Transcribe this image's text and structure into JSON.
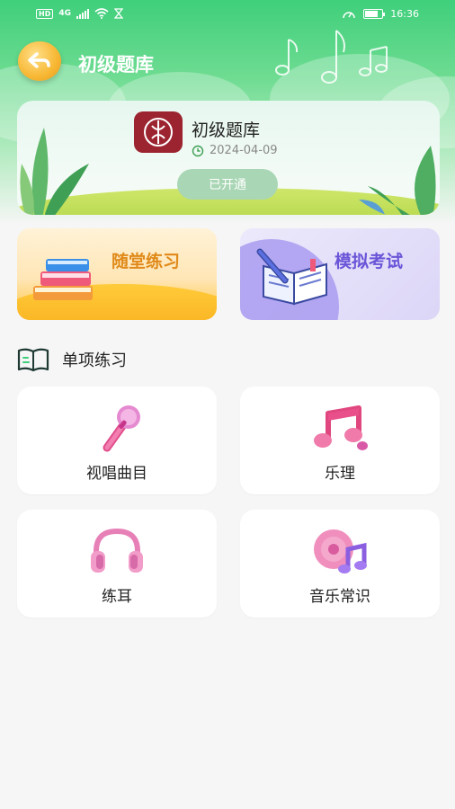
{
  "status_bar": {
    "hd": "HD",
    "network": "4G",
    "time": "16:36"
  },
  "nav": {
    "title": "初级题库",
    "back_icon": "back-arrow-icon"
  },
  "info_card": {
    "title": "初级题库",
    "date": "2024-04-09",
    "status_label": "已开通"
  },
  "features": [
    {
      "label": "随堂练习",
      "icon": "books-icon"
    },
    {
      "label": "模拟考试",
      "icon": "notebook-pen-icon"
    }
  ],
  "section": {
    "title": "单项练习",
    "icon": "book-open-icon"
  },
  "tiles": [
    {
      "label": "视唱曲目",
      "icon": "microphone-icon"
    },
    {
      "label": "乐理",
      "icon": "music-note-icon"
    },
    {
      "label": "练耳",
      "icon": "headphones-icon"
    },
    {
      "label": "音乐常识",
      "icon": "vinyl-record-icon"
    }
  ],
  "colors": {
    "brand_green": "#3fcf7b",
    "practice_orange": "#e08a1a",
    "exam_purple": "#6a55d8",
    "logo_red": "#9c2430"
  }
}
